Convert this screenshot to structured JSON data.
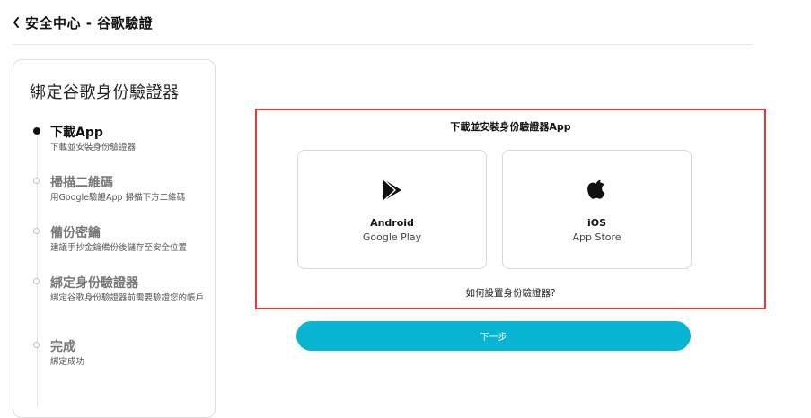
{
  "header": {
    "title": "安全中心 - 谷歌驗證"
  },
  "stepper": {
    "title": "綁定谷歌身份驗證器",
    "steps": [
      {
        "title": "下載App",
        "desc": "下載並安裝身份驗證器",
        "active": true
      },
      {
        "title": "掃描二維碼",
        "desc": "用Google驗證App 掃描下方二維碼",
        "active": false
      },
      {
        "title": "備份密鑰",
        "desc": "建議手抄金鑰備份後儲存至安全位置",
        "active": false
      },
      {
        "title": "綁定身份驗證器",
        "desc": "綁定谷歌身份驗證器前需要驗證您的帳戶",
        "active": false
      },
      {
        "title": "完成",
        "desc": "綁定成功",
        "active": false
      }
    ]
  },
  "download": {
    "heading": "下載並安裝身份驗證器App",
    "android": {
      "name": "Android",
      "store": "Google Play",
      "icon": "play-store-icon"
    },
    "ios": {
      "name": "iOS",
      "store": "App Store",
      "icon": "apple-icon"
    },
    "help_link": "如何設置身份驗證器?"
  },
  "actions": {
    "next_label": "下一步"
  },
  "colors": {
    "accent": "#07b4d2",
    "highlight": "#e53935"
  }
}
